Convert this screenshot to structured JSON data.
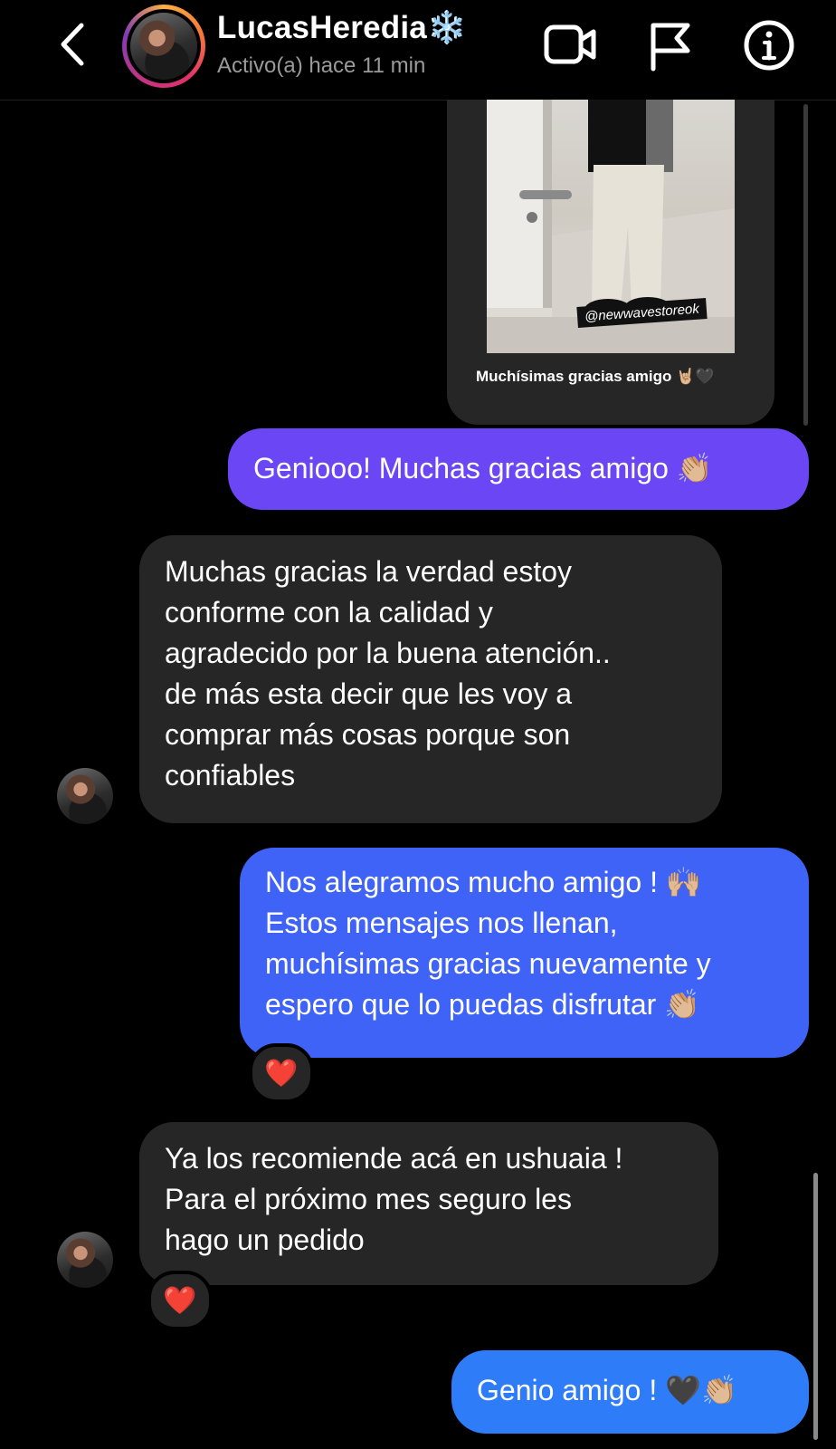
{
  "header": {
    "username": "LucasHeredia❄️",
    "status": "Activo(a) hace 11 min",
    "back_icon": "chevron-left-icon",
    "video_icon": "video-call-icon",
    "flag_icon": "flag-icon",
    "info_icon": "info-icon"
  },
  "shared_post": {
    "watermark": "@newwavestoreok",
    "caption": "Muchísimas gracias amigo 🤘🏼🖤"
  },
  "messages": [
    {
      "sender": "me",
      "text": "Geniooo! Muchas gracias amigo 👏🏼"
    },
    {
      "sender": "them",
      "lines": [
        "Muchas gracias la verdad estoy",
        "conforme con la calidad y",
        "agradecido por la buena atención..",
        "de más esta decir que les voy a",
        "comprar más cosas porque son",
        "confiables"
      ]
    },
    {
      "sender": "me",
      "lines": [
        "Nos alegramos mucho amigo ! 🙌🏼",
        "Estos mensajes nos llenan,",
        "muchísimas gracias nuevamente y",
        "espero que lo puedas disfrutar 👏🏼"
      ],
      "reaction": "❤️"
    },
    {
      "sender": "them",
      "lines": [
        "Ya los recomiende acá en ushuaia !",
        "Para el próximo mes seguro les",
        "hago un pedido"
      ],
      "reaction": "❤️"
    },
    {
      "sender": "me",
      "text": "Genio amigo ! 🖤👏🏼"
    }
  ],
  "colors": {
    "background": "#000000",
    "incoming_bubble": "#262626",
    "outgoing_purple": "#6a46f5",
    "outgoing_blue": "#3f63f7",
    "outgoing_light_blue": "#2f7cf8"
  }
}
